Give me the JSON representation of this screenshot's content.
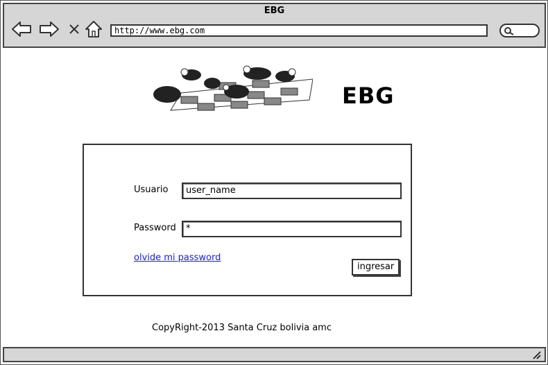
{
  "window": {
    "title": "EBG"
  },
  "browser": {
    "url": "http://www.ebg.com",
    "icons": [
      "back-arrow-icon",
      "forward-arrow-icon",
      "close-x-icon",
      "home-icon",
      "search-icon"
    ]
  },
  "header": {
    "logo_text": "EBG"
  },
  "login": {
    "user_label": "Usuario",
    "user_value": "user_name",
    "password_label": "Password",
    "password_value": "*",
    "forgot_link": "olvide mi password",
    "submit_label": "ingresar"
  },
  "footer": {
    "copyright": "CopyRight-2013 Santa Cruz bolivia amc"
  }
}
